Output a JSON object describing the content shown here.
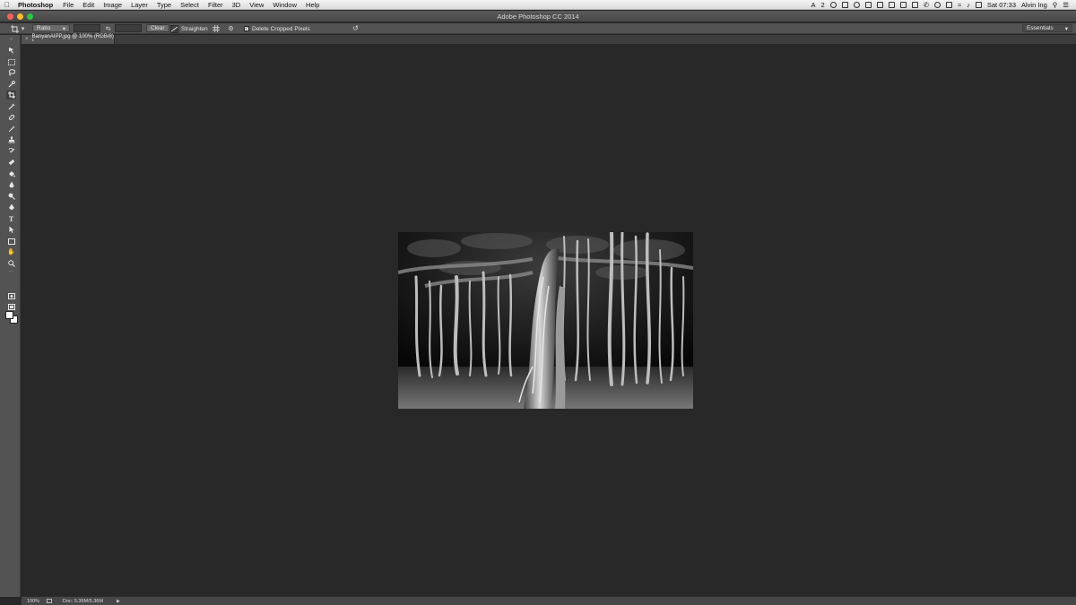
{
  "menubar": {
    "app_name": "Photoshop",
    "items": [
      "File",
      "Edit",
      "Image",
      "Layer",
      "Type",
      "Select",
      "Filter",
      "3D",
      "View",
      "Window",
      "Help"
    ],
    "badge_number": "2",
    "clock": "Sat 07:33",
    "user": "Alvin Ing"
  },
  "window": {
    "title": "Adobe Photoshop CC 2014"
  },
  "options_bar": {
    "ratio_label": "Ratio",
    "clear_label": "Clear",
    "straighten_label": "Straighten",
    "delete_cropped_label": "Delete Cropped Pixels",
    "delete_cropped_checked": true,
    "workspace_label": "Essentials"
  },
  "document": {
    "tab_title": "BanyanAIPP.jpg @ 100% (RGB/8) *",
    "close_glyph": "×"
  },
  "statusbar": {
    "zoom": "100%",
    "doc_size": "Doc: 5.36M/5.36M"
  },
  "tools": [
    "move-tool-icon",
    "marquee-tool-icon",
    "lasso-tool-icon",
    "quick-select-tool-icon",
    "crop-tool-icon",
    "eyedropper-tool-icon",
    "healing-brush-tool-icon",
    "brush-tool-icon",
    "clone-stamp-tool-icon",
    "history-brush-tool-icon",
    "eraser-tool-icon",
    "paint-bucket-tool-icon",
    "blur-tool-icon",
    "dodge-tool-icon",
    "pen-tool-icon",
    "type-tool-icon",
    "path-select-tool-icon",
    "rectangle-tool-icon",
    "hand-tool-icon",
    "zoom-tool-icon"
  ],
  "colors": {
    "foreground": "#ffffff",
    "background": "#ffffff",
    "canvas_bg": "#282828",
    "panel_bg": "#535353"
  }
}
